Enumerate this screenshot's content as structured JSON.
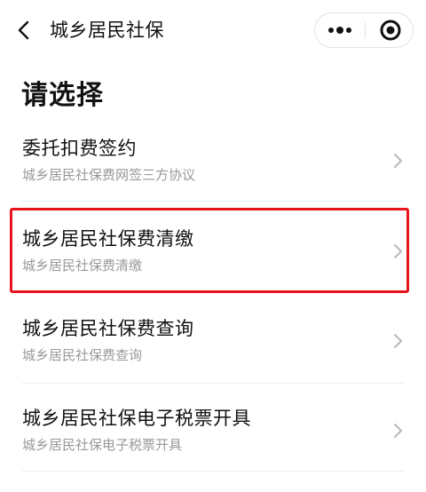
{
  "navbar": {
    "title": "城乡居民社保",
    "back_icon": "chevron-left-icon",
    "more_icon": "more-dots-icon",
    "close_icon": "target-close-icon"
  },
  "heading": "请选择",
  "items": [
    {
      "title": "委托扣费签约",
      "subtitle": "城乡居民社保费网签三方协议"
    },
    {
      "title": "城乡居民社保费清缴",
      "subtitle": "城乡居民社保费清缴"
    },
    {
      "title": "城乡居民社保费查询",
      "subtitle": "城乡居民社保费查询"
    },
    {
      "title": "城乡居民社保电子税票开具",
      "subtitle": "城乡居民社保电子税票开具"
    }
  ],
  "highlight_color": "#e8141c"
}
